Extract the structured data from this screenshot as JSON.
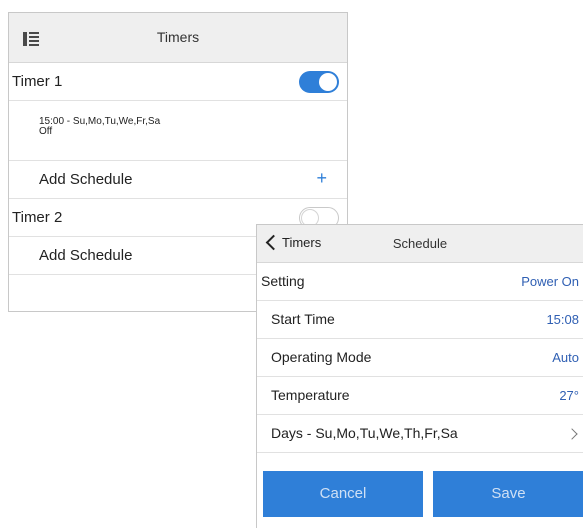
{
  "timers_panel": {
    "title": "Timers",
    "timer1": {
      "label": "Timer 1",
      "enabled": true
    },
    "schedule1": {
      "line1": "15:00 - Su,Mo,Tu,We,Fr,Sa",
      "line2": "Off"
    },
    "add_schedule_1": {
      "label": "Add Schedule",
      "icon": "+"
    },
    "timer2": {
      "label": "Timer 2",
      "enabled": false
    },
    "add_schedule_2": {
      "label": "Add Schedule"
    }
  },
  "schedule_panel": {
    "back_label": "Timers",
    "title": "Schedule",
    "rows": [
      {
        "label": "Setting",
        "value": "Power On"
      },
      {
        "label": "Start Time",
        "value": "15:08"
      },
      {
        "label": "Operating Mode",
        "value": "Auto"
      },
      {
        "label": "Temperature",
        "value": "27°"
      },
      {
        "label": "Days - Su,Mo,Tu,We,Th,Fr,Sa",
        "value": ""
      }
    ],
    "cancel_label": "Cancel",
    "save_label": "Save"
  },
  "colors": {
    "accent": "#2f7fd8",
    "value_text": "#2f5fb3",
    "header_bg": "#efefef"
  }
}
